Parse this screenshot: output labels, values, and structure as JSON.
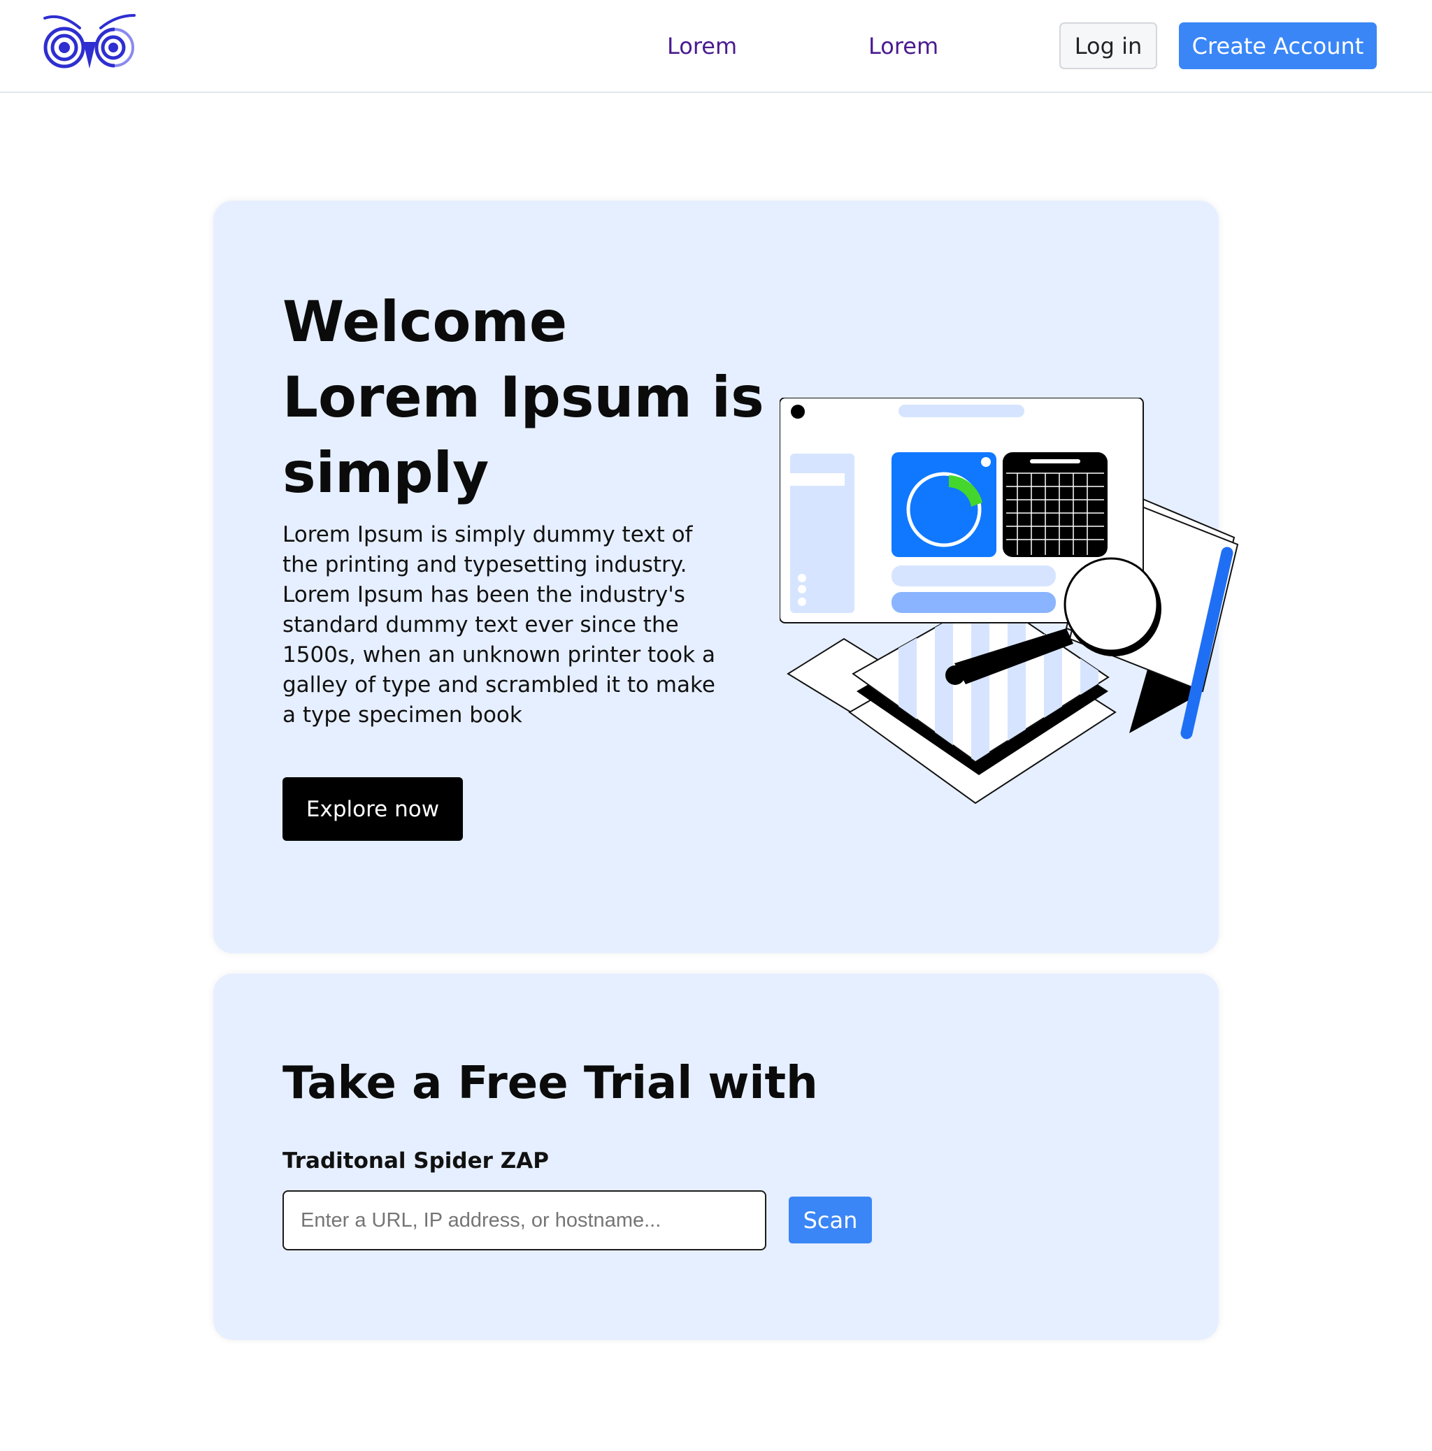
{
  "header": {
    "logo_icon": "owl-logo-icon",
    "nav": [
      {
        "label": "Lorem"
      },
      {
        "label": "Lorem"
      }
    ],
    "login_label": "Log in",
    "create_account_label": "Create Account"
  },
  "hero": {
    "title_line1": "Welcome",
    "title_line2": "Lorem Ipsum is simply",
    "body": "Lorem Ipsum is simply dummy text of the printing and typesetting industry. Lorem Ipsum has been the industry's standard dummy text ever since the 1500s, when an unknown printer took a galley of type and scrambled it to make a type specimen book",
    "cta_label": "Explore now",
    "illustration_icon": "analytics-dashboard-illustration"
  },
  "trial": {
    "title": "Take a Free Trial with",
    "field_label": "Traditonal Spider ZAP",
    "input_value": "",
    "input_placeholder": "Enter a URL, IP address, or hostname...",
    "scan_label": "Scan"
  },
  "colors": {
    "primary": "#3a86f7",
    "nav_link": "#4a1a8f",
    "card_bg": "#e6efff",
    "dark": "#000000",
    "logo": "#2e2ed1"
  }
}
